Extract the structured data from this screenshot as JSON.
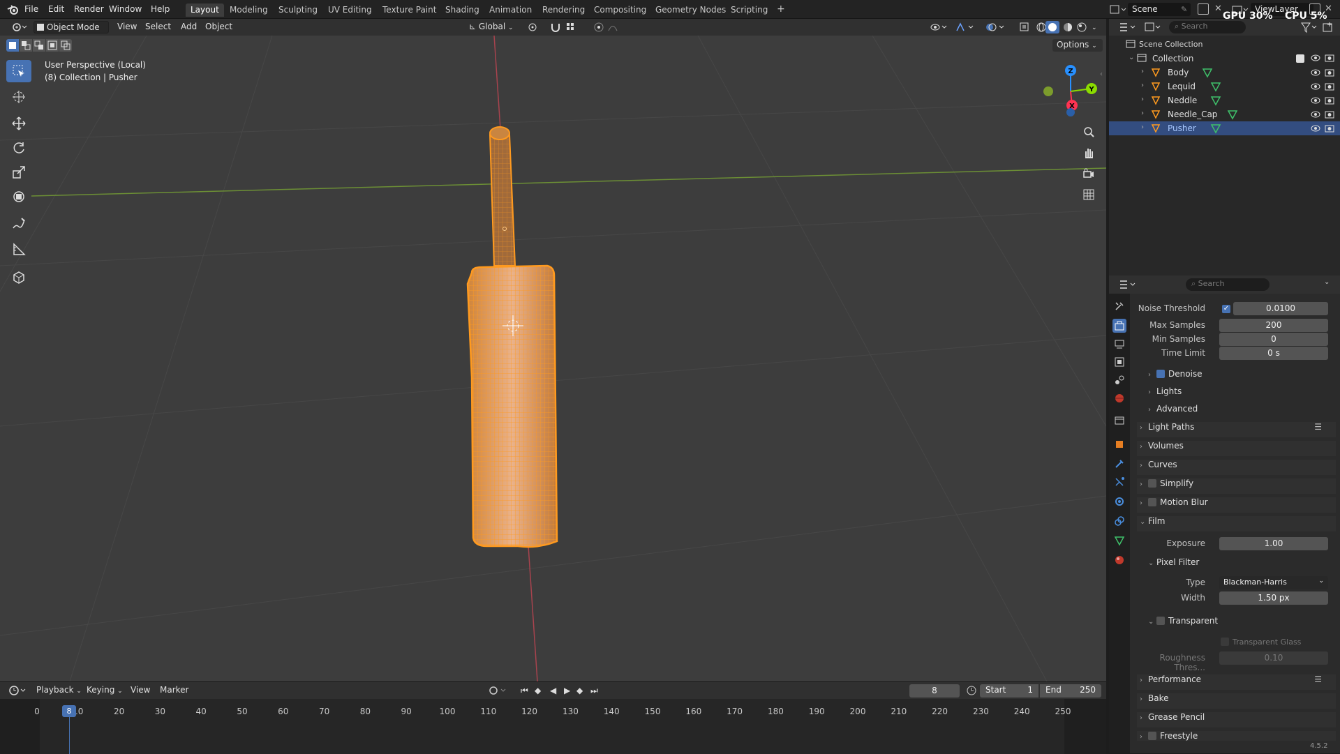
{
  "menubar": {
    "items": [
      "File",
      "Edit",
      "Render",
      "Window",
      "Help"
    ],
    "workspaces": [
      "Layout",
      "Modeling",
      "Sculpting",
      "UV Editing",
      "Texture Paint",
      "Shading",
      "Animation",
      "Rendering",
      "Compositing",
      "Geometry Nodes",
      "Scripting"
    ],
    "add_tab": "+",
    "scene": "Scene",
    "view_layer": "ViewLayer",
    "gpu_label": "GPU",
    "gpu_value": "30%",
    "cpu_label": "CPU",
    "cpu_value": "5%"
  },
  "viewport_header": {
    "mode": "Object Mode",
    "menus": [
      "View",
      "Select",
      "Add",
      "Object"
    ],
    "orientation": "Global",
    "options": "Options"
  },
  "viewport": {
    "perspective": "User Perspective (Local)",
    "collection_info": "(8) Collection | Pusher",
    "gizmo": {
      "z": "Z",
      "y": "Y",
      "x": "X"
    }
  },
  "outliner": {
    "search_placeholder": "Search",
    "scene_collection": "Scene Collection",
    "collection": "Collection",
    "objects": [
      "Body",
      "Lequid",
      "Neddle",
      "Needle_Cap",
      "Pusher"
    ],
    "selected": "Pusher"
  },
  "properties": {
    "search_placeholder": "Search",
    "noise_threshold_label": "Noise Threshold",
    "noise_threshold": "0.0100",
    "max_samples_label": "Max Samples",
    "max_samples": "200",
    "min_samples_label": "Min Samples",
    "min_samples": "0",
    "time_limit_label": "Time Limit",
    "time_limit": "0 s",
    "denoise": "Denoise",
    "lights": "Lights",
    "advanced": "Advanced",
    "light_paths": "Light Paths",
    "volumes": "Volumes",
    "curves": "Curves",
    "simplify": "Simplify",
    "motion_blur": "Motion Blur",
    "film": "Film",
    "exposure_label": "Exposure",
    "exposure": "1.00",
    "pixel_filter": "Pixel Filter",
    "type_label": "Type",
    "type_value": "Blackman-Harris",
    "width_label": "Width",
    "width_value": "1.50 px",
    "transparent": "Transparent",
    "transparent_glass": "Transparent Glass",
    "roughness_label": "Roughness Thres...",
    "roughness_value": "0.10",
    "performance": "Performance",
    "bake": "Bake",
    "grease_pencil": "Grease Pencil",
    "freestyle": "Freestyle"
  },
  "timeline": {
    "menus": [
      "Playback",
      "Keying",
      "View",
      "Marker"
    ],
    "current_frame": "8",
    "start_label": "Start",
    "start": "1",
    "end_label": "End",
    "end": "250",
    "ticks": [
      "0",
      "10",
      "20",
      "30",
      "40",
      "50",
      "60",
      "70",
      "80",
      "90",
      "100",
      "110",
      "120",
      "130",
      "140",
      "150",
      "160",
      "170",
      "180",
      "190",
      "200",
      "210",
      "220",
      "230",
      "240",
      "250"
    ],
    "playhead": "8"
  },
  "status": {
    "version": "4.5.2"
  },
  "colors": {
    "selection": "#ff9a1f",
    "accent": "#4772b3",
    "x_axis": "#ff3352",
    "y_axis": "#8bdc00",
    "z_axis": "#2890ff"
  }
}
